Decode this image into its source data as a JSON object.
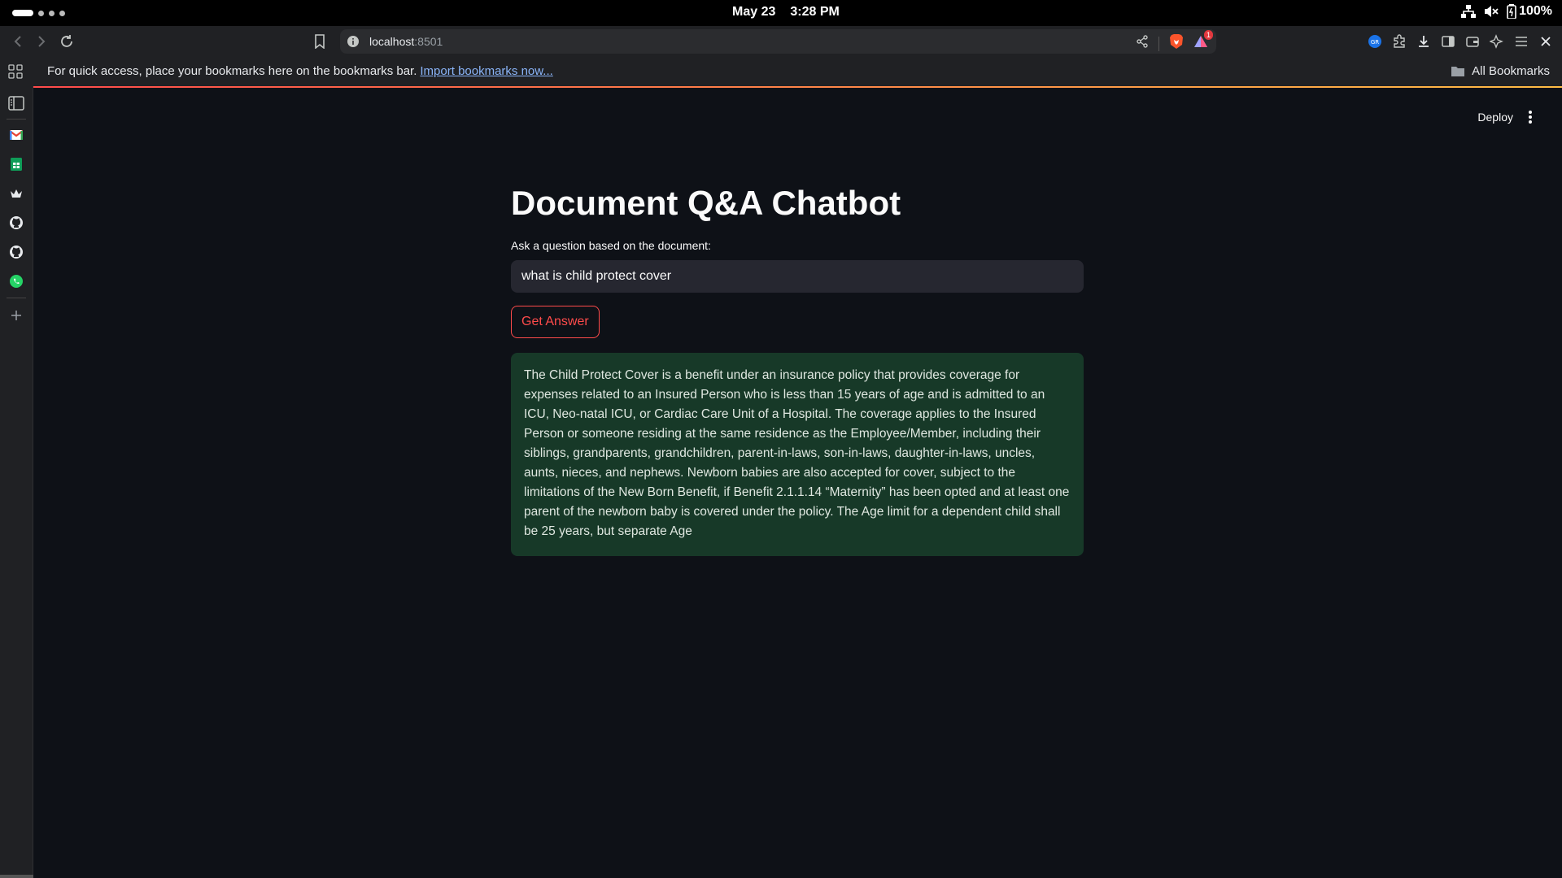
{
  "os": {
    "date": "May 23",
    "time": "3:28 PM",
    "battery": "100%"
  },
  "browser": {
    "url_host": "localhost",
    "url_port": ":8501",
    "shields_badge": "1"
  },
  "bookmarks_bar": {
    "message": "For quick access, place your bookmarks here on the bookmarks bar.",
    "import_link": "Import bookmarks now...",
    "all_bookmarks": "All Bookmarks"
  },
  "app": {
    "deploy_label": "Deploy",
    "title": "Document Q&A Chatbot",
    "question_label": "Ask a question based on the document:",
    "question_value": "what is child protect cover",
    "button_label": "Get Answer",
    "answer": "The Child Protect Cover is a benefit under an insurance policy that provides coverage for expenses related to an Insured Person who is less than 15 years of age and is admitted to an ICU, Neo-natal ICU, or Cardiac Care Unit of a Hospital. The coverage applies to the Insured Person or someone residing at the same residence as the Employee/Member, including their siblings, grandparents, grandchildren, parent-in-laws, son-in-laws, daughter-in-laws, uncles, aunts, nieces, and nephews. Newborn babies are also accepted for cover, subject to the limitations of the New Born Benefit, if Benefit 2.1.1.14 “Maternity” has been opted and at least one parent of the newborn baby is covered under the policy. The Age limit for a dependent child shall be 25 years, but separate Age"
  },
  "colors": {
    "page_bg": "#0e1117",
    "accent": "#ff4b4b",
    "answer_bg": "#173928",
    "input_bg": "#262730"
  }
}
